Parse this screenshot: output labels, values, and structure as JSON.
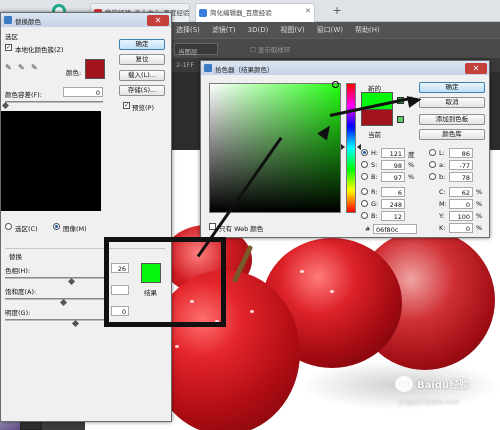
{
  "browser": {
    "tabs": [
      {
        "label": "我的经验_个人中心_百度经验"
      },
      {
        "label": "简化编辑器_百度经验"
      }
    ],
    "new_tab": "+"
  },
  "photoshop": {
    "menu": [
      "选择(S)",
      "滤镜(T)",
      "3D(D)",
      "视图(V)",
      "窗口(W)",
      "帮助(H)"
    ],
    "option_dropdown": "当图层",
    "option_check_label": "显示取样环",
    "doc_tab": "2-1FF"
  },
  "replace_color_dialog": {
    "title": "替换颜色",
    "close": "✕",
    "selection_group": "选区",
    "localized_checkbox": "本地化颜色簇(Z)",
    "color_label": "颜色:",
    "tolerance_label": "颜色容差(F):",
    "tolerance_value": "0",
    "radio_selection": "选区(C)",
    "radio_image": "图像(M)",
    "replace_group": "替换",
    "hue_label": "色相(H):",
    "hue_value": "26",
    "saturation_label": "饱和度(A):",
    "lightness_label": "明度(G):",
    "lightness_value": "0",
    "result_label": "结果",
    "buttons": {
      "ok": "确定",
      "reset": "复位",
      "load": "载入(L)...",
      "save": "存储(S)..."
    },
    "preview_label": "预览(P)",
    "colors": {
      "sample": "#a1141b",
      "result": "#06f80c"
    }
  },
  "color_picker_dialog": {
    "title": "拾色器（结果颜色）",
    "close": "✕",
    "new_label": "新的",
    "current_label": "当前",
    "buttons": {
      "ok": "确定",
      "cancel": "取消",
      "add_swatches": "添加到色板",
      "color_libraries": "颜色库"
    },
    "hsb": [
      {
        "label": "H:",
        "value": "121",
        "unit": "度"
      },
      {
        "label": "S:",
        "value": "98",
        "unit": "%"
      },
      {
        "label": "B:",
        "value": "97",
        "unit": "%"
      }
    ],
    "rgb": [
      {
        "label": "R:",
        "value": "6"
      },
      {
        "label": "G:",
        "value": "248"
      },
      {
        "label": "B:",
        "value": "12"
      }
    ],
    "lab": [
      {
        "label": "L:",
        "value": "86"
      },
      {
        "label": "a:",
        "value": "-77"
      },
      {
        "label": "b:",
        "value": "78"
      }
    ],
    "cmyk": [
      {
        "label": "C:",
        "value": "62",
        "unit": "%"
      },
      {
        "label": "M:",
        "value": "0",
        "unit": "%"
      },
      {
        "label": "Y:",
        "value": "100",
        "unit": "%"
      },
      {
        "label": "K:",
        "value": "0",
        "unit": "%"
      }
    ],
    "hex_label": "#",
    "hex_value": "06f80c",
    "web_only_label": "只有 Web 颜色",
    "colors": {
      "new": "#06f80c",
      "current": "#a1141b"
    }
  },
  "watermark": {
    "brand": "Baidu经验",
    "url": "jingyan.baidu.com"
  }
}
